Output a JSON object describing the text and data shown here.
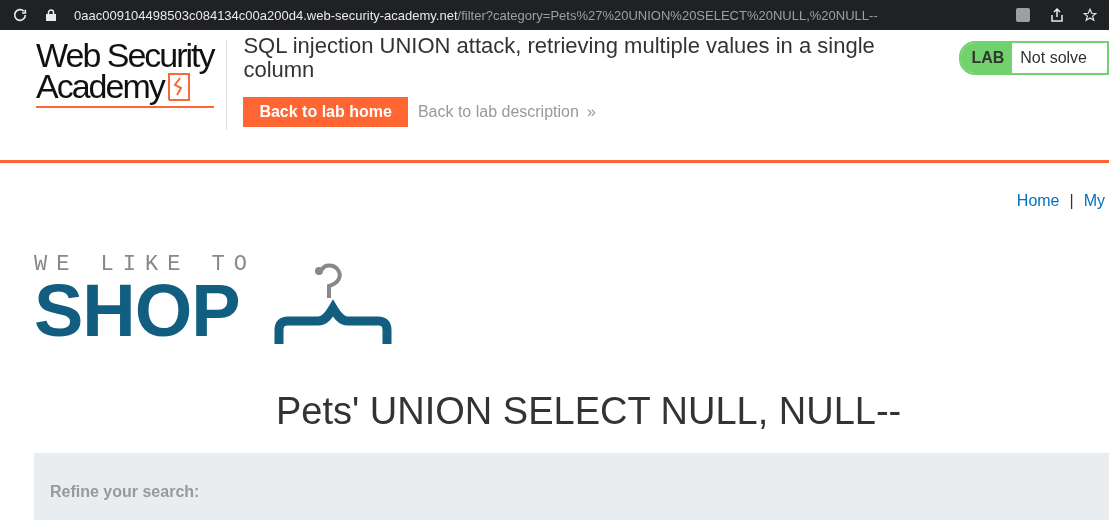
{
  "address_bar": {
    "host": "0aac009104498503c084134c00a200d4.web-security-academy.net",
    "path": "/filter?category=Pets%27%20UNION%20SELECT%20NULL,%20NULL--"
  },
  "lab_header": {
    "logo_lines": [
      "Web Security",
      "Academy"
    ],
    "title": "SQL injection UNION attack, retrieving multiple values in a single column",
    "primary_button": "Back to lab home",
    "secondary_link": "Back to lab description",
    "secondary_link_glyph": "»",
    "status_label": "LAB",
    "status_text": "Not solve"
  },
  "nav": {
    "links": [
      "Home",
      "My"
    ],
    "separator": "|"
  },
  "shop_logo": {
    "tagline": "WE LIKE TO",
    "word": "SHOP"
  },
  "heading": "Pets' UNION SELECT NULL, NULL--",
  "filter_panel": {
    "label": "Refine your search:"
  }
}
